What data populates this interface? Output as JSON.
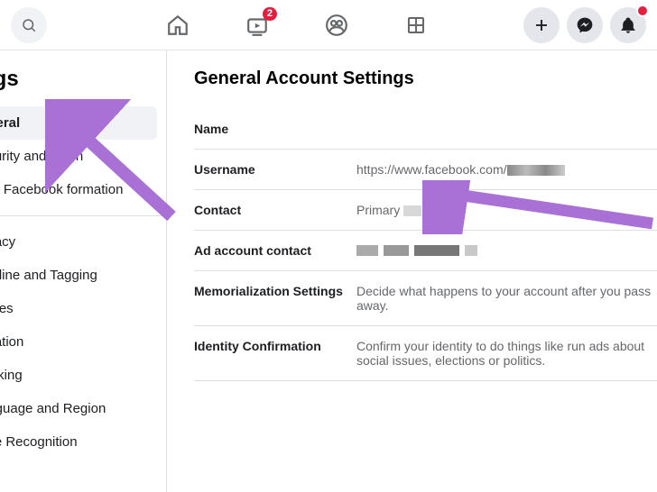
{
  "topbar": {
    "watch_badge": "2"
  },
  "sidebar": {
    "title": "ngs",
    "items": [
      "eneral",
      "ecurity and Login",
      "our Facebook formation",
      "rivacy",
      "meline and Tagging",
      "tories",
      "ocation",
      "locking",
      "anguage and Region",
      "ace Recognition"
    ]
  },
  "main": {
    "title": "General Account Settings",
    "rows": {
      "name": {
        "label": "Name",
        "value": ""
      },
      "username": {
        "label": "Username",
        "value": "https://www.facebook.com/"
      },
      "contact": {
        "label": "Contact",
        "value": "Primary"
      },
      "ad_contact": {
        "label": "Ad account contact",
        "value": ""
      },
      "memorialization": {
        "label": "Memorialization Settings",
        "value": "Decide what happens to your account after you pass away."
      },
      "identity": {
        "label": "Identity Confirmation",
        "value": "Confirm your identity to do things like run ads about social issues, elections or politics."
      }
    }
  }
}
